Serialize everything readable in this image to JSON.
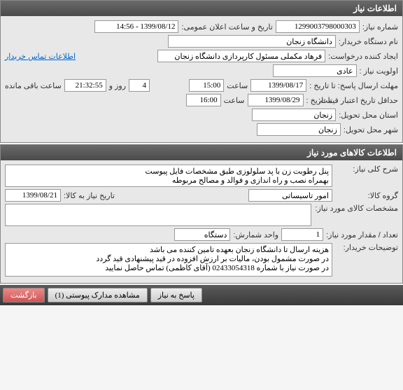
{
  "panel1": {
    "title": "اطلاعات نیاز",
    "need_number_label": "شماره نیاز:",
    "need_number": "1299003798000303",
    "announce_label": "تاریخ و ساعت اعلان عمومی:",
    "announce_value": "1399/08/12 - 14:56",
    "buyer_org_label": "نام دستگاه خریدار:",
    "buyer_org": "دانشگاه زنجان",
    "creator_label": "ایجاد کننده درخواست:",
    "creator": "فرهاد مکملی مسئول کارپردازی دانشگاه زنجان",
    "contact_link": "اطلاعات تماس خریدار",
    "priority_label": "اولویت نیاز :",
    "priority": "عادی",
    "deadline_label": "مهلت ارسال پاسخ:  تا تاریخ :",
    "deadline_date": "1399/08/17",
    "time_label": "ساعت",
    "deadline_time": "15:00",
    "remain_days": "4",
    "remain_days_label": "روز و",
    "remain_time": "21:32:55",
    "remain_time_label": "ساعت باقی مانده",
    "validity_label": "حداقل تاریخ اعتبار قیمت:",
    "validity_to_label": "تا تاریخ :",
    "validity_date": "1399/08/29",
    "validity_time": "16:00",
    "province_label": "استان محل تحویل:",
    "province": "زنجان",
    "city_label": "شهر محل تحویل:",
    "city": "زنجان"
  },
  "panel2": {
    "title": "اطلاعات کالاهای مورد نیاز",
    "desc_label": "شرح کلی نیاز:",
    "desc": "پنل رطوبت زن با پد سلولوزی طبق مشخصات فایل پیوست\nبهمراه نصب و راه اندازی و فوالد و مصالح مربوطه",
    "group_label": "گروه کالا:",
    "group": "امور تاسیساتی",
    "need_date_label": "تاریخ نیاز به کالا:",
    "need_date": "1399/08/21",
    "spec_label": "مشخصات کالای مورد نیاز:",
    "spec": "",
    "qty_label": "تعداد / مقدار مورد نیاز:",
    "qty": "1",
    "unit_label": "واحد شمارش:",
    "unit": "دستگاه",
    "notes_label": "توضیحات خریدار:",
    "notes": "هزینه ارسال تا دانشگاه زنجان بعهده تامین کننده می باشد\nدر صورت مشمول بودن، مالیات بر ارزش افزوده در قید پیشنهادی قید گردد\nدر صورت نیاز با شماره 02433054318 (آقای کاظمی) تماس حاصل نمایید"
  },
  "buttons": {
    "reply": "پاسخ به نیاز",
    "attachments": "مشاهده مدارک پیوستی (1)",
    "back": "بازگشت"
  }
}
